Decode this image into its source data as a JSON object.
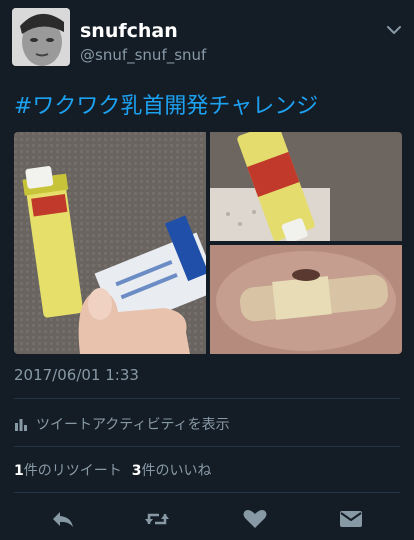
{
  "user": {
    "display_name": "snufchan",
    "handle": "@snuf_snuf_snuf"
  },
  "tweet": {
    "text": "#ワクワク乳首開発チャレンジ",
    "timestamp": "2017/06/01 1:33"
  },
  "activity": {
    "label": "ツイートアクティビティを表示"
  },
  "stats": {
    "retweet_count": "1",
    "retweet_label": "件のリツイート",
    "like_count": "3",
    "like_label": "件のいいね"
  },
  "actions": {
    "icons": [
      "reply-icon",
      "retweet-icon",
      "like-icon",
      "message-icon"
    ]
  },
  "colors": {
    "background": "#141d26",
    "link": "#1da1f2",
    "secondary_text": "#8899a6",
    "divider": "#243447"
  }
}
